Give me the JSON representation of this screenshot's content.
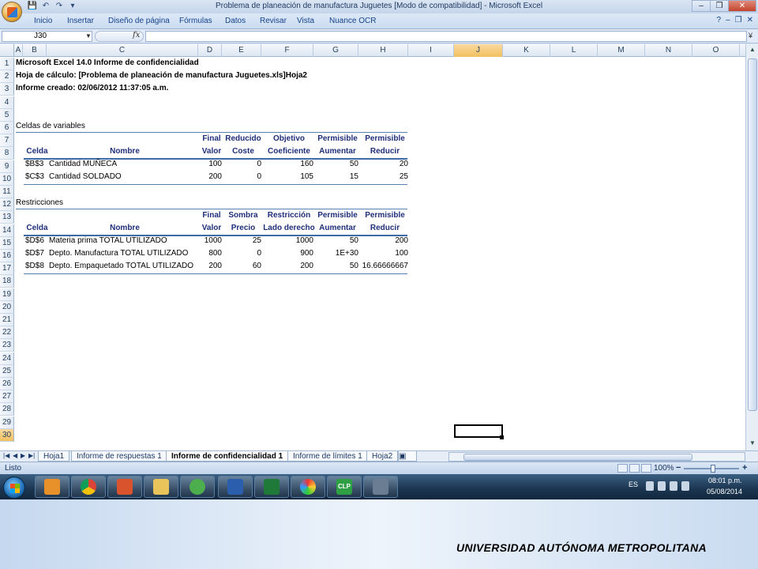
{
  "window": {
    "title": "Problema de planeación de manufactura Juguetes  [Modo de compatibilidad] - Microsoft Excel",
    "controls": [
      "–",
      "❐",
      "✕"
    ]
  },
  "quick_access": [
    "💾",
    "↶",
    "↷",
    "▾"
  ],
  "ribbon": {
    "tabs": [
      "Inicio",
      "Insertar",
      "Diseño de página",
      "Fórmulas",
      "Datos",
      "Revisar",
      "Vista",
      "Nuance OCR"
    ],
    "right": [
      "?",
      "–",
      "❐",
      "✕"
    ]
  },
  "formula_bar": {
    "name_box": "J30",
    "fx": "fx",
    "formula": ""
  },
  "columns": [
    "A",
    "B",
    "C",
    "D",
    "E",
    "F",
    "G",
    "H",
    "I",
    "J",
    "K",
    "L",
    "M",
    "N",
    "O"
  ],
  "selected_column": "J",
  "rows": [
    "1",
    "2",
    "3",
    "4",
    "5",
    "6",
    "7",
    "8",
    "9",
    "10",
    "11",
    "12",
    "13",
    "14",
    "15",
    "16",
    "17",
    "18",
    "19",
    "20",
    "21",
    "22",
    "23",
    "24",
    "25",
    "26",
    "27",
    "28",
    "29",
    "30"
  ],
  "selected_row": "30",
  "report": {
    "line1": "Microsoft Excel 14.0 Informe de confidencialidad",
    "line2": "Hoja de cálculo: [Problema de planeación de manufactura Juguetes.xls]Hoja2",
    "line3": "Informe creado: 02/06/2012 11:37:05 a.m.",
    "variables_title": "Celdas de variables",
    "variables_head1": [
      "",
      "",
      "Final",
      "Reducido",
      "Objetivo",
      "Permisible",
      "Permisible"
    ],
    "variables_head2": [
      "Celda",
      "Nombre",
      "Valor",
      "Coste",
      "Coeficiente",
      "Aumentar",
      "Reducir"
    ],
    "variables_rows": [
      [
        "$B$3",
        "Cantidad MUÑECA",
        "100",
        "0",
        "160",
        "50",
        "20"
      ],
      [
        "$C$3",
        "Cantidad SOLDADO",
        "200",
        "0",
        "105",
        "15",
        "25"
      ]
    ],
    "restrictions_title": "Restricciones",
    "restrictions_head1": [
      "",
      "",
      "Final",
      "Sombra",
      "Restricción",
      "Permisible",
      "Permisible"
    ],
    "restrictions_head2": [
      "Celda",
      "Nombre",
      "Valor",
      "Precio",
      "Lado derecho",
      "Aumentar",
      "Reducir"
    ],
    "restrictions_rows": [
      [
        "$D$6",
        "Materia prima TOTAL UTILIZADO",
        "1000",
        "25",
        "1000",
        "50",
        "200"
      ],
      [
        "$D$7",
        "Depto. Manufactura TOTAL UTILIZADO",
        "800",
        "0",
        "900",
        "1E+30",
        "100"
      ],
      [
        "$D$8",
        "Depto. Empaquetado TOTAL UTILIZADO",
        "200",
        "60",
        "200",
        "50",
        "16.66666667"
      ]
    ]
  },
  "sheet_tabs": [
    "Hoja1",
    "Informe de respuestas 1",
    "Informe de confidencialidad 1",
    "Informe de límites 1",
    "Hoja2"
  ],
  "active_sheet_tab": "Informe de confidencialidad 1",
  "status": {
    "text": "Listo",
    "zoom": "100%"
  },
  "taskbar": {
    "apps": [
      "media",
      "chrome",
      "office",
      "explorer",
      "messenger",
      "word",
      "excel",
      "paint",
      "clp",
      "calculator"
    ],
    "clp_label": "CLP",
    "lang": "ES",
    "time": "08:01 p.m.",
    "date": "05/08/2014"
  },
  "footer": "UNIVERSIDAD AUTÓNOMA METROPOLITANA",
  "colors": {
    "header_text": "#1f2f7a",
    "rule": "#3e6aa6",
    "selected_header": "#f1c15f"
  }
}
